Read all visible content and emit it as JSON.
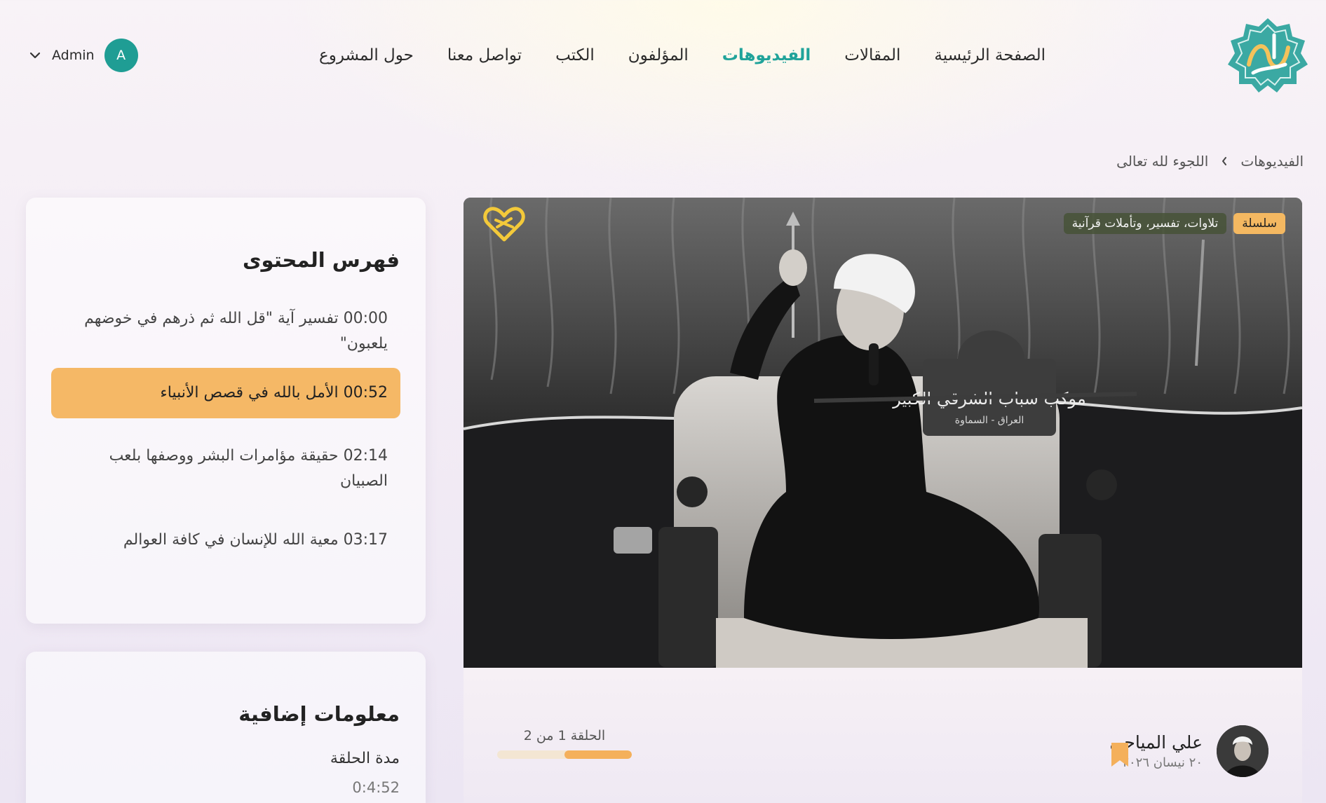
{
  "nav": {
    "items": [
      {
        "label": "الصفحة الرئيسية"
      },
      {
        "label": "المقالات"
      },
      {
        "label": "الفيديوهات",
        "active": true
      },
      {
        "label": "المؤلفون"
      },
      {
        "label": "الكتب"
      },
      {
        "label": "تواصل معنا"
      },
      {
        "label": "حول المشروع"
      }
    ],
    "active_color": "#20a39a"
  },
  "user": {
    "name": "Admin",
    "initial": "A",
    "avatar_color": "#1f9d94"
  },
  "breadcrumb": {
    "root": "الفيديوهات",
    "current": "اللجوء لله تعالى"
  },
  "video": {
    "badge_series": "سلسلة",
    "badge_topic": "تلاوات، تفسير، وتأملات قرآنية",
    "overlay_lectern_title": "موكب شباب الشرقي الكبير",
    "overlay_lectern_sub": "العراق - السماوة"
  },
  "author": {
    "name": "علي المياحي",
    "date": "٢٠ نيسان ٢٠٢٦"
  },
  "episode": {
    "label": "الحلقة 1 من 2",
    "progress": 0.5
  },
  "toc": {
    "title": "فهرس المحتوى",
    "items": [
      {
        "text": "00:00 تفسير آية \"قل الله ثم ذرهم في خوضهم يلعبون\""
      },
      {
        "text": "00:52 الأمل بالله في قصص الأنبياء",
        "active": true
      },
      {
        "text": "02:14 حقيقة مؤامرات البشر ووصفها بلعب الصبيان"
      },
      {
        "text": "03:17 معية الله للإنسان في كافة العوالم"
      }
    ],
    "highlight_color": "#f5b866"
  },
  "extra": {
    "title": "معلومات إضافية",
    "duration_label": "مدة الحلقة",
    "duration_value": "0:4:52"
  }
}
